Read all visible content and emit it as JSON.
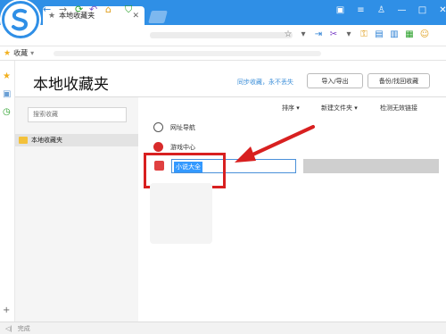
{
  "browser": {
    "tab_title": "本地收藏夹",
    "status_text": "完成",
    "favbar_label": "收藏"
  },
  "page": {
    "title": "本地收藏夹",
    "sync_text": "同步收藏，永不丢失",
    "import_export_label": "导入/导出",
    "backup_label": "备份/找回收藏",
    "search_placeholder": "搜索收藏"
  },
  "sidebar": {
    "folder": "本地收藏夹"
  },
  "list_header": {
    "sort": "排序",
    "new_folder": "新建文件夹",
    "check_links": "检测无效链接"
  },
  "items": [
    {
      "label": "网址导航",
      "icon": "globe-icon"
    },
    {
      "label": "游戏中心",
      "icon": "game-center-icon"
    },
    {
      "label": "小说大全",
      "icon": "novel-icon",
      "editing": true
    }
  ],
  "colors": {
    "accent": "#2f8fe6",
    "highlight": "#d82020",
    "link": "#3b8ed8",
    "selection": "#3399ff"
  }
}
